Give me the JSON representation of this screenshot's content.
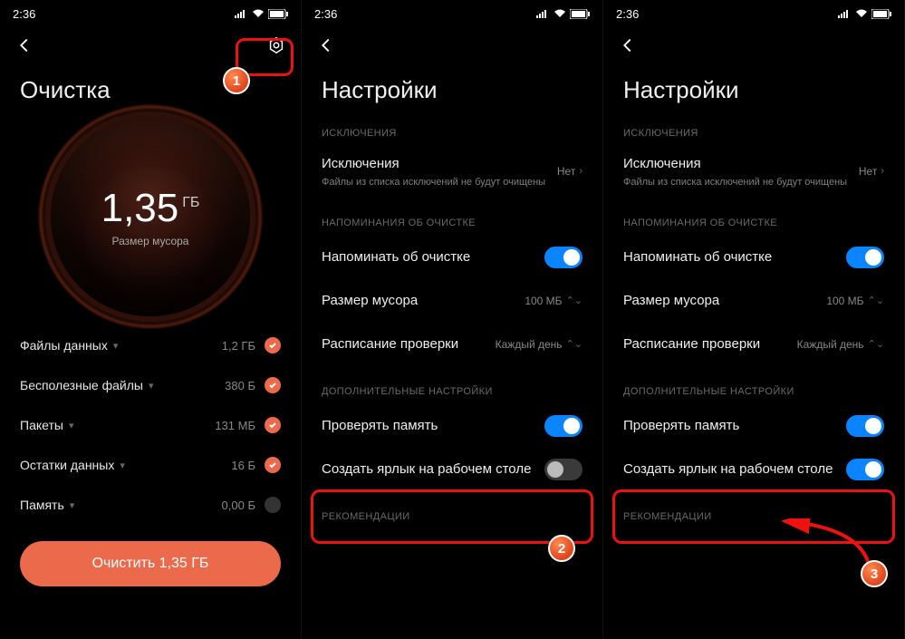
{
  "status": {
    "time": "2:36"
  },
  "panel1": {
    "title": "Очистка",
    "dial_value": "1,35",
    "dial_unit": "ГБ",
    "dial_sub": "Размер мусора",
    "rows": [
      {
        "label": "Файлы данных",
        "value": "1,2 ГБ",
        "checked": true
      },
      {
        "label": "Бесполезные файлы",
        "value": "380 Б",
        "checked": true
      },
      {
        "label": "Пакеты",
        "value": "131 МБ",
        "checked": true
      },
      {
        "label": "Остатки данных",
        "value": "16 Б",
        "checked": true
      },
      {
        "label": "Память",
        "value": "0,00 Б",
        "checked": false
      }
    ],
    "button": "Очистить 1,35 ГБ"
  },
  "settings": {
    "title": "Настройки",
    "sec_excl": "ИСКЛЮЧЕНИЯ",
    "excl_label": "Исключения",
    "excl_desc": "Файлы из списка исключений не будут очищены",
    "excl_value": "Нет",
    "sec_remind": "НАПОМИНАНИЯ ОБ ОЧИСТКЕ",
    "remind_label": "Напоминать об очистке",
    "size_label": "Размер мусора",
    "size_value": "100 МБ",
    "sched_label": "Расписание проверки",
    "sched_value": "Каждый день",
    "sec_extra": "ДОПОЛНИТЕЛЬНЫЕ НАСТРОЙКИ",
    "mem_label": "Проверять память",
    "shortcut_label": "Создать ярлык на рабочем столе",
    "sec_reco": "РЕКОМЕНДАЦИИ"
  },
  "badges": {
    "b1": "1",
    "b2": "2",
    "b3": "3"
  }
}
